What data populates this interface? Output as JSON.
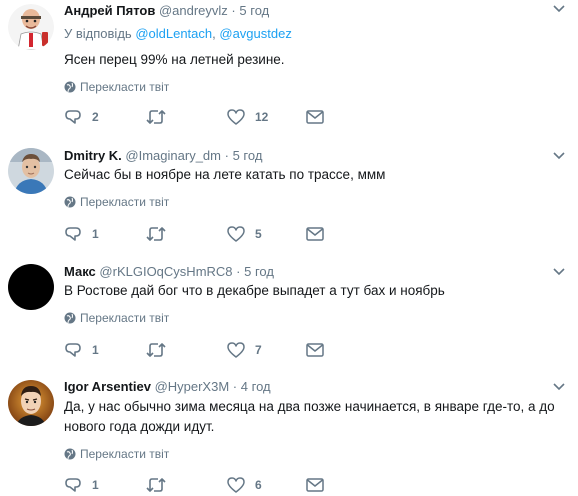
{
  "translate_label": "Перекласти твіт",
  "colors": {
    "link": "#1da1f2",
    "secondary": "#657786",
    "text": "#14171a"
  },
  "tweets": [
    {
      "name": "Андрей Пятов",
      "handle": "@andreyvlz",
      "sep": "·",
      "time": "5 год",
      "reply_prefix": "У відповідь",
      "mentions": [
        "@oldLentach",
        "@avgustdez"
      ],
      "text": "Ясен перец 99% на летней резине.",
      "reply_count": "2",
      "retweet_count": "",
      "like_count": "12",
      "avatar": "cartoon-avatar"
    },
    {
      "name": "Dmitry K.",
      "handle": "@Imaginary_dm",
      "sep": "·",
      "time": "5 год",
      "text": "Сейчас бы в ноябре на лете катать по трассе, ммм",
      "reply_count": "1",
      "retweet_count": "",
      "like_count": "5",
      "avatar": "photo-avatar"
    },
    {
      "name": "Макс",
      "handle": "@rKLGIOqCysHmRC8",
      "sep": "·",
      "time": "5 год",
      "text": "В Ростове дай бог что в декабре выпадет а тут бах и ноябрь",
      "reply_count": "1",
      "retweet_count": "",
      "like_count": "7",
      "avatar": "black-avatar"
    },
    {
      "name": "Igor Arsentiev",
      "handle": "@HyperX3M",
      "sep": "·",
      "time": "4 год",
      "text": "Да, у нас обычно зима месяца на два позже начинается, в январе где-то, а до нового года дожди идут.",
      "reply_count": "1",
      "retweet_count": "",
      "like_count": "6",
      "avatar": "portrait-avatar"
    }
  ]
}
